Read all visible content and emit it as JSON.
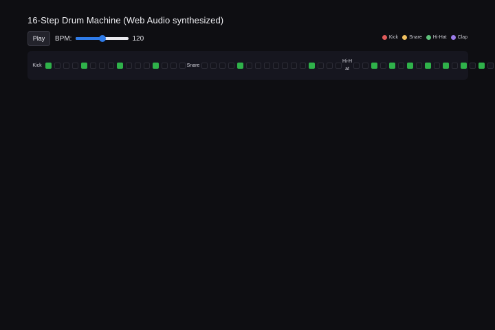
{
  "title": "16-Step Drum Machine (Web Audio synthesized)",
  "controls": {
    "play_label": "Play",
    "bpm_label": "BPM:",
    "bpm_value": "120",
    "bpm_fraction": 0.5
  },
  "legend": [
    {
      "label": "Kick",
      "color": "#e05a5a"
    },
    {
      "label": "Snare",
      "color": "#f0c060"
    },
    {
      "label": "Hi-Hat",
      "color": "#5ec07a"
    },
    {
      "label": "Clap",
      "color": "#9a7ae8"
    }
  ],
  "tracks": [
    {
      "label": "Kick",
      "steps": [
        1,
        0,
        0,
        0,
        1,
        0,
        0,
        0,
        1,
        0,
        0,
        0,
        1,
        0,
        0,
        0
      ]
    },
    {
      "label": "Snare",
      "steps": [
        0,
        0,
        0,
        0,
        1,
        0,
        0,
        0,
        0,
        0,
        0,
        0,
        1,
        0,
        0,
        0
      ]
    },
    {
      "label": "Hi-Hat",
      "steps": [
        0,
        0,
        1,
        0,
        1,
        0,
        1,
        0,
        1,
        0,
        1,
        0,
        1,
        0,
        1,
        0
      ]
    }
  ],
  "colors": {
    "active_step": "#2fb24a",
    "accent": "#2f7be8"
  }
}
